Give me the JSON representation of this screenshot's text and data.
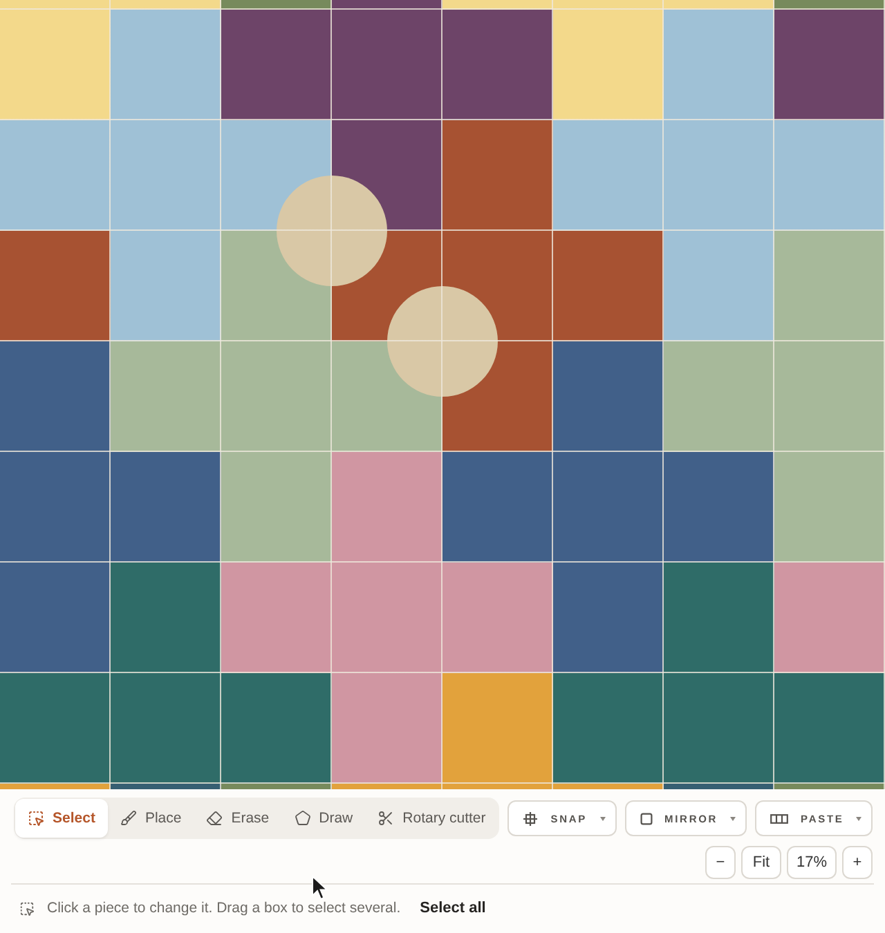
{
  "quilt": {
    "rows": [
      {
        "cells": [
          {
            "color": "#f3d98b",
            "circle": false
          },
          {
            "color": "#f3d98b",
            "circle": false
          },
          {
            "color": "#778a5c",
            "circle": false
          },
          {
            "color": "#6d4468",
            "circle": false
          },
          {
            "color": "#f3d98b",
            "circle": false
          },
          {
            "color": "#f3d98b",
            "circle": false
          },
          {
            "color": "#f3d98b",
            "circle": false
          },
          {
            "color": "#778a5c",
            "circle": false
          }
        ]
      },
      {
        "cells": [
          {
            "color": "#f3d98b",
            "circle": false
          },
          {
            "color": "#9fc1d6",
            "circle": false
          },
          {
            "color": "#6d4468",
            "circle": false
          },
          {
            "color": "#6d4468",
            "circle": false
          },
          {
            "color": "#6d4468",
            "circle": false
          },
          {
            "color": "#f3d98b",
            "circle": false
          },
          {
            "color": "#9fc1d6",
            "circle": false
          },
          {
            "color": "#6d4468",
            "circle": false
          }
        ]
      },
      {
        "cells": [
          {
            "color": "#9fc1d6",
            "circle": false
          },
          {
            "color": "#9fc1d6",
            "circle": false
          },
          {
            "color": "#9fc1d6",
            "circle": false
          },
          {
            "color": "#6d4468",
            "circle": false
          },
          {
            "color": "#a75232",
            "circle": false
          },
          {
            "color": "#9fc1d6",
            "circle": false
          },
          {
            "color": "#9fc1d6",
            "circle": false
          },
          {
            "color": "#9fc1d6",
            "circle": false
          }
        ]
      },
      {
        "cells": [
          {
            "color": "#a75232",
            "circle": false
          },
          {
            "color": "#9fc1d6",
            "circle": false
          },
          {
            "color": "#a7b99a",
            "circle": false
          },
          {
            "color": "#a75232",
            "circle": true
          },
          {
            "color": "#a75232",
            "circle": false
          },
          {
            "color": "#a75232",
            "circle": false
          },
          {
            "color": "#9fc1d6",
            "circle": false
          },
          {
            "color": "#a7b99a",
            "circle": false
          }
        ]
      },
      {
        "cells": [
          {
            "color": "#416089",
            "circle": false
          },
          {
            "color": "#a7b99a",
            "circle": false
          },
          {
            "color": "#a7b99a",
            "circle": false
          },
          {
            "color": "#a7b99a",
            "circle": false
          },
          {
            "color": "#a75232",
            "circle": true
          },
          {
            "color": "#416089",
            "circle": false
          },
          {
            "color": "#a7b99a",
            "circle": false
          },
          {
            "color": "#a7b99a",
            "circle": false
          }
        ]
      },
      {
        "cells": [
          {
            "color": "#416089",
            "circle": false
          },
          {
            "color": "#416089",
            "circle": false
          },
          {
            "color": "#a7b99a",
            "circle": false
          },
          {
            "color": "#d096a2",
            "circle": false
          },
          {
            "color": "#416089",
            "circle": false
          },
          {
            "color": "#416089",
            "circle": false
          },
          {
            "color": "#416089",
            "circle": false
          },
          {
            "color": "#a7b99a",
            "circle": false
          }
        ]
      },
      {
        "cells": [
          {
            "color": "#416089",
            "circle": false
          },
          {
            "color": "#2f6c68",
            "circle": false
          },
          {
            "color": "#d096a2",
            "circle": false
          },
          {
            "color": "#d096a2",
            "circle": false
          },
          {
            "color": "#d096a2",
            "circle": false
          },
          {
            "color": "#416089",
            "circle": false
          },
          {
            "color": "#2f6c68",
            "circle": false
          },
          {
            "color": "#d096a2",
            "circle": false
          }
        ]
      },
      {
        "cells": [
          {
            "color": "#2f6c68",
            "circle": false
          },
          {
            "color": "#2f6c68",
            "circle": false
          },
          {
            "color": "#2f6c68",
            "circle": false
          },
          {
            "color": "#d096a2",
            "circle": false
          },
          {
            "color": "#e2a23c",
            "circle": false
          },
          {
            "color": "#2f6c68",
            "circle": false
          },
          {
            "color": "#2f6c68",
            "circle": false
          },
          {
            "color": "#2f6c68",
            "circle": false
          }
        ]
      },
      {
        "cells": [
          {
            "color": "#e2a23c",
            "circle": false
          },
          {
            "color": "#365f72",
            "circle": false
          },
          {
            "color": "#778a5c",
            "circle": false
          },
          {
            "color": "#e2a23c",
            "circle": false
          },
          {
            "color": "#e2a23c",
            "circle": false
          },
          {
            "color": "#e2a23c",
            "circle": false
          },
          {
            "color": "#365f72",
            "circle": false
          },
          {
            "color": "#778a5c",
            "circle": false
          }
        ]
      }
    ]
  },
  "toolbar": {
    "tools": [
      {
        "label": "Select",
        "selected": true
      },
      {
        "label": "Place",
        "selected": false
      },
      {
        "label": "Erase",
        "selected": false
      },
      {
        "label": "Draw",
        "selected": false
      },
      {
        "label": "Rotary cutter",
        "selected": false
      }
    ],
    "options": [
      {
        "label": "SNAP"
      },
      {
        "label": "MIRROR"
      },
      {
        "label": "PASTE"
      }
    ],
    "zoom": {
      "zoom_out": "−",
      "fit": "Fit",
      "level_text": "17%",
      "zoom_in": "+"
    }
  },
  "hint": {
    "text": "Click a piece to change it. Drag a box to select several.",
    "action": "Select all"
  }
}
